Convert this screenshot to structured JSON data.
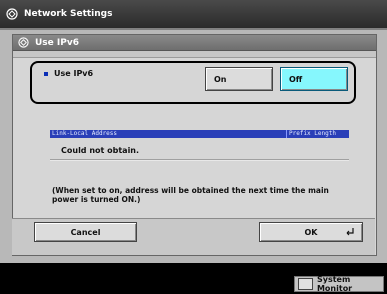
{
  "window": {
    "title": "Network Settings"
  },
  "dialog": {
    "title": "Use IPv6"
  },
  "option": {
    "label": "Use IPv6",
    "on_label": "On",
    "off_label": "Off",
    "selected": "Off"
  },
  "address_table": {
    "col_address": "Link-Local Address",
    "col_prefix": "Prefix Length",
    "value": "Could not obtain."
  },
  "note": "(When set to on, address will be obtained the next time the main power is turned ON.)",
  "buttons": {
    "cancel": "Cancel",
    "ok": "OK"
  },
  "status": {
    "system_monitor": "System Monitor"
  },
  "colors": {
    "selected_button": "#86f7fd",
    "table_header": "#2a3fb8"
  }
}
